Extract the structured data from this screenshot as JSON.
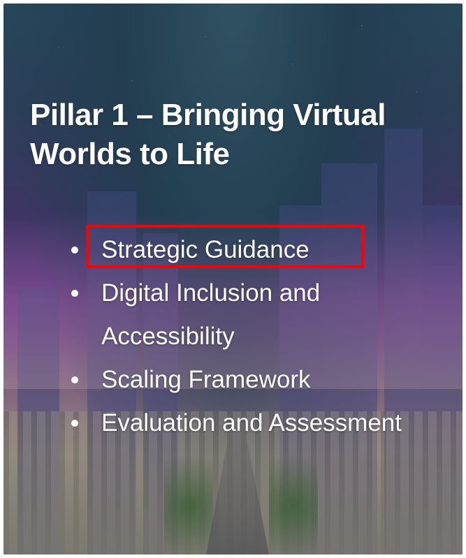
{
  "slide": {
    "title_line1": "Pillar 1 – Bringing Virtual",
    "title_line2": "Worlds to Life",
    "bullets": [
      {
        "line1": "Strategic Guidance",
        "line2": ""
      },
      {
        "line1": "Digital Inclusion and",
        "line2": "Accessibility"
      },
      {
        "line1": "Scaling Framework",
        "line2": ""
      },
      {
        "line1": "Evaluation and Assessment",
        "line2": ""
      }
    ]
  },
  "highlight": {
    "target": "Strategic Guidance",
    "color": "#ff0000"
  },
  "colors": {
    "text": "#ffffff",
    "background_top": "#27475a",
    "background_mid": "#55397a"
  }
}
